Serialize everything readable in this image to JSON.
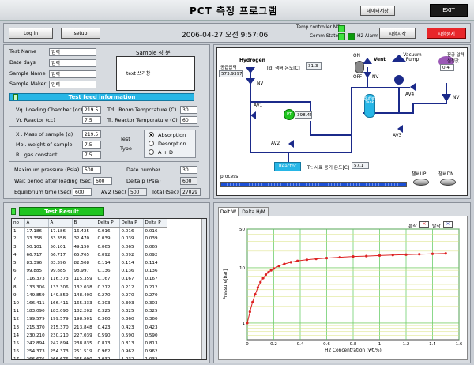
{
  "header": {
    "title": "PCT 측정 프로그램",
    "data_save": "데이터저장",
    "exit": "EXIT",
    "login": "Log in",
    "setup": "setup",
    "datetime": "2006-04-27 오전 9:57:06",
    "temp_controller_label": "Temp controller NG",
    "comm_state_label": "Comm State",
    "h2_alarm_label": "H2 Alarm",
    "start_test": "시험시작",
    "stop_test": "시험중지"
  },
  "sample": {
    "test_name_label": "Test Name",
    "test_name_value": "입력",
    "date_days_label": "Date days",
    "date_days_value": "입력",
    "sample_name_label": "Sample Name",
    "sample_name_value": "입력",
    "sample_maker_label": "Sample Maker",
    "sample_maker_value": "입력",
    "composition_title": "Sample 성 분",
    "composition_text": "text 쓰기창"
  },
  "feed": {
    "title": "Test feed information",
    "vq_label": "Vq. Loading Chamber (cc)",
    "vq_value": "219.5",
    "vr_label": "Vr. Reactor (cc)",
    "vr_value": "7.5",
    "td_label": "Td . Room Tempcrature (C)",
    "td_value": "30",
    "tr_label": "Tr. Reactor Tempcrature (C)",
    "tr_value": "60",
    "x_label": "X . Mass of sample (g)",
    "x_value": "219.5",
    "mol_label": "Mol. weight of sample",
    "mol_value": "7.5",
    "r_label": "R . gas constant",
    "r_value": "7.5",
    "test_label": "Test",
    "type_label": "Type",
    "absorption": "Absorption",
    "desorption": "Desorption",
    "a_d": "A  +  D",
    "max_p_label": "Maximum pressure (Psia)",
    "max_p_value": "500",
    "date_number_label": "Date number",
    "date_number_value": "30",
    "wait_label": "Wait period after loading (Sec)",
    "wait_value": "600",
    "delta_p_label": "Delta p (Psia)",
    "delta_p_value": "600",
    "eq_label": "Equilibrium time (Sec)",
    "eq_value": "600",
    "av2_label": "AV2 (Sec)",
    "av2_value": "500",
    "total_label": "Total (Sec)",
    "total_value": "27029"
  },
  "diagram": {
    "hydrogen": "Hydrogen",
    "supply_pressure_label": "공급압력",
    "supply_pressure_value": "573.9397",
    "td_label": "Td: 챔버 온도[C]",
    "td_value": "31.3",
    "nv": "NV",
    "av1": "AV1",
    "av2": "AV2",
    "av3": "AV3",
    "av4": "AV4",
    "pt": "PT",
    "pt_value": "398.46",
    "on": "ON",
    "off": "OFF",
    "vent": "Vent",
    "vacuum_pump": "Vacuum Pump",
    "vacuum_pressure_label": "진공 압력 설정값",
    "vacuum_pressure_value": "0.4",
    "buffer": "Buffer Tank",
    "reactor": "Reactor",
    "tr_label": "Tr: 시료 용기 온도[C]",
    "tr_value": "57.1",
    "process_label": "process",
    "chamber_up": "챔버UP",
    "chamber_dn": "챔버DN"
  },
  "result": {
    "title": "Test Result",
    "columns": [
      "no",
      "A",
      "A",
      "B",
      "Delta P",
      "Delta P",
      "Delta P"
    ],
    "rows": [
      [
        "1",
        "17.186",
        "17.186",
        "16.425",
        "0.016",
        "0.016",
        "0.016"
      ],
      [
        "2",
        "33.358",
        "33.358",
        "32.470",
        "0.039",
        "0.039",
        "0.039"
      ],
      [
        "3",
        "50.101",
        "50.101",
        "49.150",
        "0.065",
        "0.065",
        "0.065"
      ],
      [
        "4",
        "66.717",
        "66.717",
        "65.765",
        "0.092",
        "0.092",
        "0.092"
      ],
      [
        "5",
        "83.396",
        "83.396",
        "82.508",
        "0.114",
        "0.114",
        "0.114"
      ],
      [
        "6",
        "99.885",
        "99.885",
        "98.997",
        "0.136",
        "0.136",
        "0.136"
      ],
      [
        "7",
        "116.373",
        "116.373",
        "115.359",
        "0.167",
        "0.167",
        "0.167"
      ],
      [
        "8",
        "133.306",
        "133.306",
        "132.038",
        "0.212",
        "0.212",
        "0.212"
      ],
      [
        "9",
        "149.859",
        "149.859",
        "148.400",
        "0.270",
        "0.270",
        "0.270"
      ],
      [
        "10",
        "166.411",
        "166.411",
        "165.333",
        "0.303",
        "0.303",
        "0.303"
      ],
      [
        "11",
        "183.090",
        "183.090",
        "182.202",
        "0.325",
        "0.325",
        "0.325"
      ],
      [
        "12",
        "199.579",
        "199.579",
        "198.501",
        "0.360",
        "0.360",
        "0.360"
      ],
      [
        "13",
        "215.370",
        "215.370",
        "213.848",
        "0.423",
        "0.423",
        "0.423"
      ],
      [
        "14",
        "230.210",
        "230.210",
        "227.039",
        "0.590",
        "0.590",
        "0.590"
      ],
      [
        "15",
        "242.894",
        "242.894",
        "238.835",
        "0.813",
        "0.813",
        "0.813"
      ],
      [
        "16",
        "254.373",
        "254.373",
        "251.519",
        "0.962",
        "0.962",
        "0.962"
      ],
      [
        "17",
        "266.676",
        "266.676",
        "265.090",
        "1.032",
        "1.032",
        "1.032"
      ],
      [
        "18",
        "279.677",
        "279.677",
        "276.633",
        "1.194",
        "1.194",
        "1.194"
      ],
      [
        "19",
        "291.845",
        "291.845",
        "288.877",
        "1.313",
        "1.313",
        "1.313"
      ]
    ]
  },
  "chart_tabs": {
    "tab1": "Delt W",
    "tab2": "Delta H/M",
    "legend1": "흡착",
    "legend2": "탈착"
  },
  "chart_data": {
    "type": "scatter",
    "xlabel": "H2 Concentration (wt.%)",
    "ylabel": "Pressure[bar]",
    "ylog": true,
    "xlim": [
      0,
      1.6
    ],
    "ylim": [
      0.5,
      50
    ],
    "x_ticks": [
      "0",
      "0.2",
      "0.4",
      "0.6",
      "0.8",
      "1",
      "1.2",
      "1.4",
      "1.6"
    ],
    "y_ticks": [
      "1",
      "10",
      "50"
    ],
    "grid": true,
    "series": [
      {
        "name": "흡착",
        "x": [
          0.0,
          0.02,
          0.04,
          0.06,
          0.08,
          0.1,
          0.12,
          0.14,
          0.16,
          0.18,
          0.2,
          0.24,
          0.28,
          0.33,
          0.38,
          0.45,
          0.52,
          0.6,
          0.7,
          0.8,
          0.9,
          1.0,
          1.1,
          1.2,
          1.3,
          1.4,
          1.5
        ],
        "y": [
          1.0,
          1.6,
          2.4,
          3.3,
          4.4,
          5.5,
          6.5,
          7.5,
          8.3,
          9.0,
          9.7,
          10.8,
          11.7,
          12.6,
          13.3,
          14.0,
          14.5,
          15.0,
          15.5,
          16.0,
          16.3,
          16.7,
          17.0,
          17.3,
          17.6,
          17.9,
          18.2
        ]
      }
    ]
  }
}
